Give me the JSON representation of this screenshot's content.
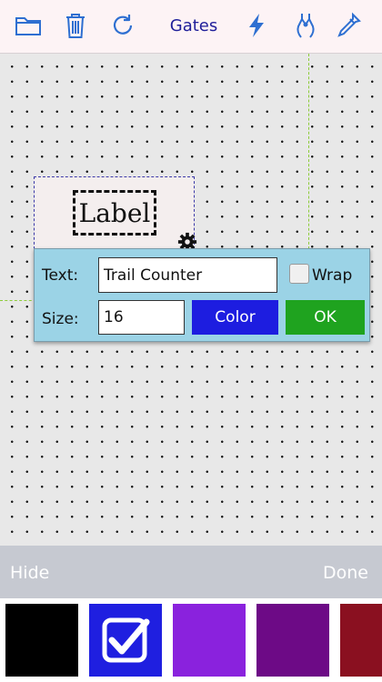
{
  "toolbar": {
    "title": "Gates",
    "icons": [
      "folder-icon",
      "trash-icon",
      "refresh-icon",
      "lightning-icon",
      "wire-cutter-icon",
      "eyedropper-icon"
    ],
    "icon_color": "#2e6fd1"
  },
  "canvas": {
    "label_component": {
      "text": "Label"
    }
  },
  "popup": {
    "text_label": "Text:",
    "text_value": "Trail Counter",
    "wrap_label": "Wrap",
    "wrap_checked": false,
    "size_label": "Size:",
    "size_value": "16",
    "color_button": "Color",
    "ok_button": "OK",
    "color_button_bg": "#1d1de0",
    "ok_button_bg": "#1fa31f"
  },
  "bottom_bar": {
    "hide_label": "Hide",
    "done_label": "Done"
  },
  "swatches": [
    {
      "name": "black",
      "color": "#000000",
      "selected": false
    },
    {
      "name": "blue",
      "color": "#1f1fe0",
      "selected": true
    },
    {
      "name": "violet",
      "color": "#8a22dd",
      "selected": false
    },
    {
      "name": "purple",
      "color": "#6d0a86",
      "selected": false
    },
    {
      "name": "maroon",
      "color": "#8a1020",
      "selected": false
    }
  ]
}
